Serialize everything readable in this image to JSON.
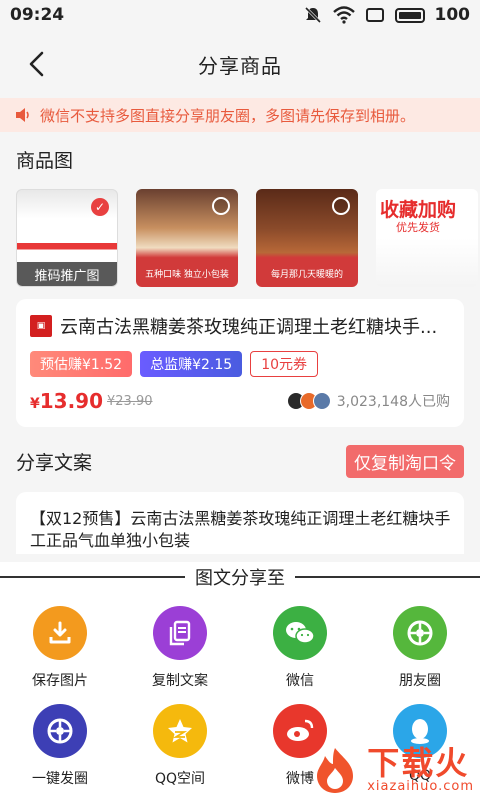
{
  "status": {
    "time": "09:24",
    "battery": "100"
  },
  "nav": {
    "title": "分享商品"
  },
  "notice": {
    "text": "微信不支持多图直接分享朋友圈，多图请先保存到相册。"
  },
  "product_images": {
    "title": "商品图",
    "thumb1_badge": "推码推广图",
    "thumb2_caption": "五种口味 独立小包装",
    "thumb3_caption": "每月那几天暖暖的",
    "thumb4_title": "收藏加购",
    "thumb4_sub": "优先发货"
  },
  "product": {
    "title": "云南古法黑糖姜茶玫瑰纯正调理土老红糖块手...",
    "tag_estimate": "预估赚¥1.52",
    "tag_supervise": "总监赚¥2.15",
    "tag_coupon": "10元券",
    "price_symbol": "¥",
    "price": "13.90",
    "original_price": "¥23.90",
    "buyers": "3,023,148人已购"
  },
  "share_copy": {
    "title": "分享文案",
    "copy_button": "仅复制淘口令",
    "text": "【双12预售】云南古法黑糖姜茶玫瑰纯正调理土老红糖块手工正品气血单独小包装"
  },
  "share_sheet": {
    "title": "图文分享至",
    "items": [
      {
        "label": "保存图片",
        "icon": "download-icon",
        "color": "#f39a1e"
      },
      {
        "label": "复制文案",
        "icon": "copy-icon",
        "color": "#9b3fd6"
      },
      {
        "label": "微信",
        "icon": "wechat-icon",
        "color": "#3cb043"
      },
      {
        "label": "朋友圈",
        "icon": "moments-icon",
        "color": "#55b73c"
      },
      {
        "label": "一键发圈",
        "icon": "moments-icon",
        "color": "#3d3fb5"
      },
      {
        "label": "QQ空间",
        "icon": "qzone-icon",
        "color": "#f5b90d"
      },
      {
        "label": "微博",
        "icon": "weibo-icon",
        "color": "#e8372c"
      },
      {
        "label": "QQ",
        "icon": "qq-icon",
        "color": "#2ba6e8"
      }
    ]
  },
  "watermark": {
    "brand": "下载火",
    "url": "xiazaihuo.com"
  }
}
